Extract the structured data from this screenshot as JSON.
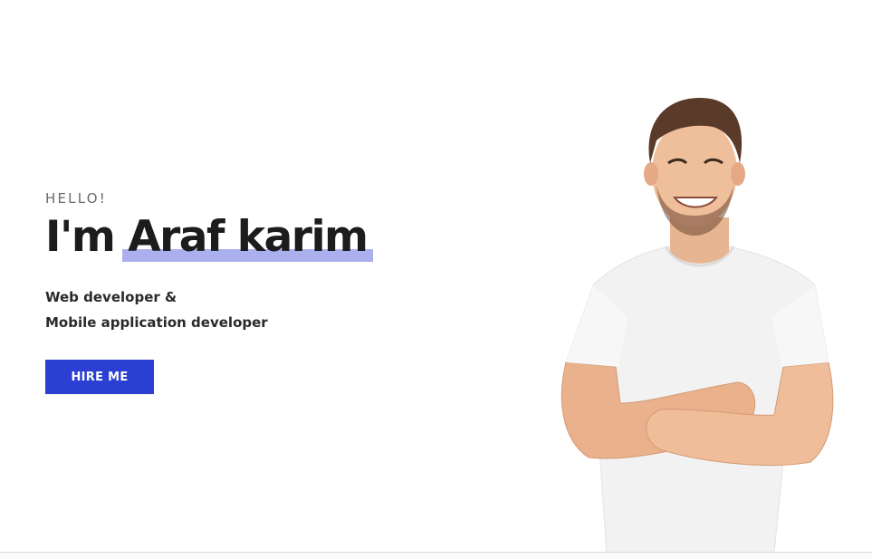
{
  "hero": {
    "greeting": "HELLO!",
    "headline_prefix": "I'm ",
    "headline_name": "Araf karim",
    "roles": [
      "Web developer &",
      "Mobile application developer"
    ],
    "cta_label": "HIRE ME"
  },
  "colors": {
    "accent": "#2b3fd3",
    "highlight": "#aab0ee",
    "text": "#1c1c1c"
  },
  "portrait": {
    "alt": "smiling man with crossed arms"
  }
}
